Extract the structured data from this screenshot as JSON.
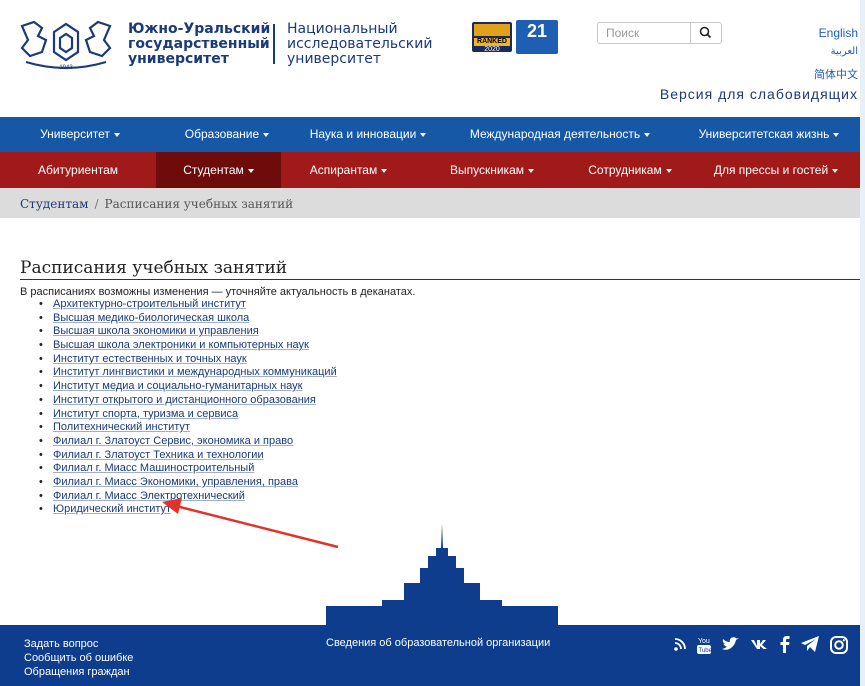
{
  "header": {
    "year": "1943",
    "uni_name_lines": [
      "Южно-Уральский",
      "государственный",
      "университет"
    ],
    "nri_lines": [
      "Национальный",
      "исследовательский",
      "университет"
    ],
    "badge_ranked": "RANKED",
    "badge_year": "2020",
    "badge_21": "21",
    "search_placeholder": "Поиск",
    "lang_en": "English",
    "lang_ar": "العربية",
    "lang_zh": "简体中文",
    "accessible_version": "Версия для слабовидящих"
  },
  "nav_main": [
    {
      "label": "Университет"
    },
    {
      "label": "Образование"
    },
    {
      "label": "Наука и инновации"
    },
    {
      "label": "Международная деятельность"
    },
    {
      "label": "Университетская жизнь"
    }
  ],
  "nav_sub": [
    {
      "label": "Абитуриентам",
      "dropdown": false
    },
    {
      "label": "Студентам",
      "dropdown": true,
      "active": true
    },
    {
      "label": "Аспирантам",
      "dropdown": true
    },
    {
      "label": "Выпускникам",
      "dropdown": true
    },
    {
      "label": "Сотрудникам",
      "dropdown": true
    },
    {
      "label": "Для прессы и гостей",
      "dropdown": true
    }
  ],
  "breadcrumb": {
    "parent": "Студентам",
    "separator": "/",
    "current": "Расписания учебных занятий"
  },
  "content": {
    "title": "Расписания учебных занятий",
    "notice": "В расписаниях возможны изменения — уточняйте актуальность в деканатах.",
    "items": [
      "Архитектурно-строительный институт",
      "Высшая медико-биологическая школа",
      "Высшая школа экономики и управления",
      "Высшая школа электроники и компьютерных наук",
      "Институт естественных и точных наук",
      "Институт лингвистики и международных коммуникаций",
      "Институт медиа и социально-гуманитарных наук",
      "Институт открытого и дистанционного образования",
      "Институт спорта, туризма и сервиса",
      "Политехнический институт",
      "Филиал г. Златоуст Сервис, экономика и право",
      "Филиал г. Златоуст Техника и технологии",
      "Филиал г. Миасс Машиностроительный",
      "Филиал г. Миасс Экономики, управления, права",
      "Филиал г. Миасс Электротехнический",
      "Юридический институт"
    ]
  },
  "footer": {
    "links": [
      "Задать вопрос",
      "Сообщить об ошибке",
      "Обращения граждан"
    ],
    "center": "Сведения об образовательной организации",
    "social_icons": [
      "rss-icon",
      "youtube-icon",
      "twitter-icon",
      "vk-icon",
      "facebook-icon",
      "telegram-icon",
      "instagram-icon"
    ]
  },
  "colors": {
    "nav_main": "#1658a6",
    "nav_sub": "#a11a1a",
    "nav_sub_active": "#6e0c0c",
    "footer": "#0d3d8c",
    "arrow": "#e0342b",
    "skyline": "#0d3d8c"
  }
}
